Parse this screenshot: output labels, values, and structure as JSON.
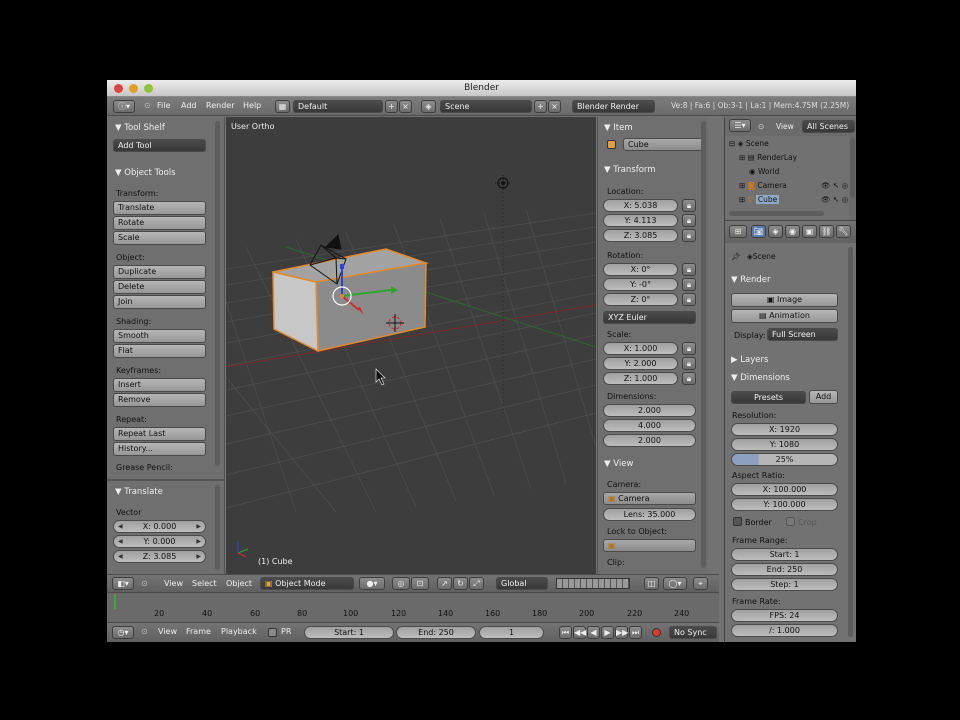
{
  "window": {
    "title": "Blender"
  },
  "infobar": {
    "menus": [
      "File",
      "Add",
      "Render",
      "Help"
    ],
    "screen_layout": "Default",
    "scene": "Scene",
    "render_engine": "Blender Render",
    "stats": "Ve:8 | Fa:6 | Ob:3-1 | La:1 | Mem:4.75M (2.25M)"
  },
  "toolshelf": {
    "title": "Tool Shelf",
    "add_tool": "Add Tool",
    "object_tools": "Object Tools",
    "transform_label": "Transform:",
    "transform_buttons": [
      "Translate",
      "Rotate",
      "Scale"
    ],
    "object_label": "Object:",
    "object_buttons": [
      "Duplicate",
      "Delete",
      "Join"
    ],
    "shading_label": "Shading:",
    "shading_buttons": [
      "Smooth",
      "Flat"
    ],
    "keyframes_label": "Keyframes:",
    "keyframe_buttons": [
      "Insert",
      "Remove"
    ],
    "repeat_label": "Repeat:",
    "repeat_buttons": [
      "Repeat Last",
      "History..."
    ],
    "grease_pencil_label": "Grease Pencil:",
    "translate_panel": "Translate",
    "vector_label": "Vector",
    "vector": [
      "X: 0.000",
      "Y: 0.000",
      "Z: 3.085"
    ]
  },
  "viewport": {
    "view_name": "User Ortho",
    "object_info": "(1) Cube"
  },
  "view_header": {
    "menus": [
      "View",
      "Select",
      "Object"
    ],
    "mode": "Object Mode",
    "orientation": "Global"
  },
  "npanel": {
    "item_title": "Item",
    "object_name": "Cube",
    "transform_title": "Transform",
    "location_label": "Location:",
    "location": [
      "X: 5.038",
      "Y: 4.113",
      "Z: 3.085"
    ],
    "rotation_label": "Rotation:",
    "rotation": [
      "X: 0°",
      "Y: -0°",
      "Z: 0°"
    ],
    "rotation_mode": "XYZ Euler",
    "scale_label": "Scale:",
    "scale": [
      "X: 1.000",
      "Y: 2.000",
      "Z: 1.000"
    ],
    "dimensions_label": "Dimensions:",
    "dimensions": [
      "2.000",
      "4.000",
      "2.000"
    ],
    "view_title": "View",
    "camera_label": "Camera:",
    "camera_value": "Camera",
    "lens": "Lens: 35.000",
    "lock_label": "Lock to Object:",
    "clip_label": "Clip:"
  },
  "timeline": {
    "ticks": [
      "20",
      "40",
      "60",
      "80",
      "100",
      "120",
      "140",
      "160",
      "180",
      "200",
      "220",
      "240"
    ],
    "menus": [
      "View",
      "Frame",
      "Playback"
    ],
    "pr_label": "PR",
    "start": "Start: 1",
    "end": "End: 250",
    "current": "1",
    "sync": "No Sync"
  },
  "outliner": {
    "view_menu": "View",
    "filter": "All Scenes",
    "items": [
      "Scene",
      "RenderLay",
      "World",
      "Camera",
      "Cube"
    ]
  },
  "properties": {
    "scene_name": "Scene",
    "render_title": "Render",
    "image_btn": "Image",
    "animation_btn": "Animation",
    "display_label": "Display:",
    "display_value": "Full Screen",
    "layers_title": "Layers",
    "dimensions_title": "Dimensions",
    "presets": "Presets",
    "add_btn": "Add",
    "resolution_label": "Resolution:",
    "res_x": "X: 1920",
    "res_y": "Y: 1080",
    "res_pct": "25%",
    "aspect_label": "Aspect Ratio:",
    "aspect_x": "X: 100.000",
    "aspect_y": "Y: 100.000",
    "border": "Border",
    "crop": "Crop",
    "frame_range_label": "Frame Range:",
    "start": "Start: 1",
    "end": "End: 250",
    "step": "Step: 1",
    "frame_rate_label": "Frame Rate:",
    "fps": "FPS: 24",
    "base": "/: 1.000"
  }
}
